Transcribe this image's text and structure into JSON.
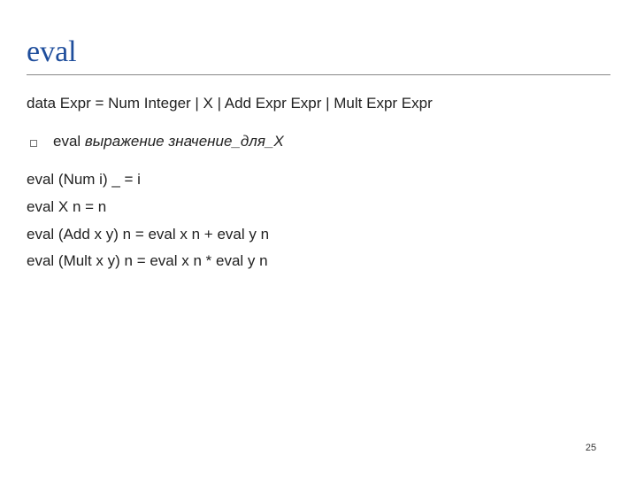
{
  "title": "eval",
  "data_decl": "data Expr = Num Integer | X | Add Expr Expr | Mult Expr Expr",
  "bullet": {
    "prefix": "eval ",
    "italic": "выражение значение_для_X"
  },
  "code": {
    "line1": "eval (Num i)  _ = i",
    "line2": "eval X n = n",
    "line3": "eval (Add x y) n = eval  x n + eval y n",
    "line4": "eval (Mult x y) n = eval  x n * eval y n"
  },
  "page_number": "25"
}
